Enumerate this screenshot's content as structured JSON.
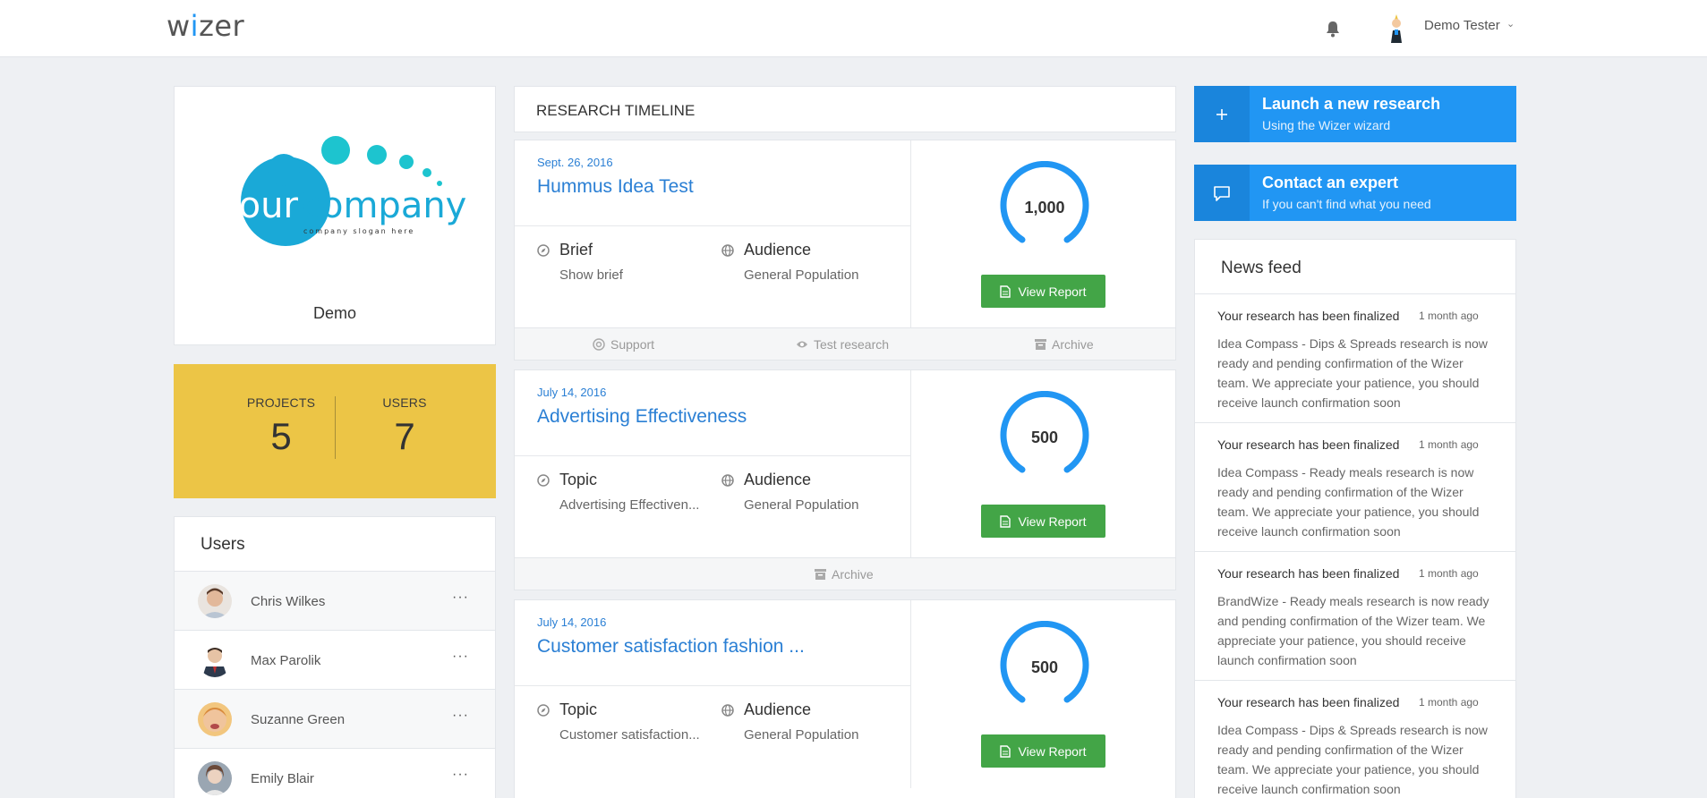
{
  "header": {
    "logo_text_a": "w",
    "logo_text_i": "i",
    "logo_text_b": "zer",
    "user_name": "Demo Tester",
    "icons": [
      "bell-icon",
      "chevron-down-icon"
    ]
  },
  "company": {
    "logo_word_a": "your",
    "logo_word_b": "company",
    "logo_slogan": "company slogan here",
    "name": "Demo"
  },
  "stats": {
    "projects_label": "PROJECTS",
    "projects_value": "5",
    "users_label": "USERS",
    "users_value": "7",
    "color": "#ecc546"
  },
  "users": {
    "title": "Users",
    "items": [
      {
        "name": "Chris Wilkes",
        "more": "···"
      },
      {
        "name": "Max Parolik",
        "more": "···"
      },
      {
        "name": "Suzanne Green",
        "more": "···"
      },
      {
        "name": "Emily Blair",
        "more": "···"
      }
    ]
  },
  "timeline": {
    "title": "RESEARCH TIMELINE",
    "items": [
      {
        "date": "Sept. 26, 2016",
        "title": "Hummus Idea Test",
        "field1_label": "Brief",
        "field1_value": "Show brief",
        "field2_label": "Audience",
        "field2_value": "General Population",
        "count": "1,000",
        "button": "View Report",
        "footer": [
          "Support",
          "Test research",
          "Archive"
        ]
      },
      {
        "date": "July 14, 2016",
        "title": "Advertising Effectiveness",
        "field1_label": "Topic",
        "field1_value": "Advertising Effectiven...",
        "field2_label": "Audience",
        "field2_value": "General Population",
        "count": "500",
        "button": "View Report",
        "footer": [
          "Archive"
        ]
      },
      {
        "date": "July 14, 2016",
        "title": "Customer satisfaction fashion ...",
        "field1_label": "Topic",
        "field1_value": "Customer satisfaction...",
        "field2_label": "Audience",
        "field2_value": "General Population",
        "count": "500",
        "button": "View Report",
        "footer": []
      }
    ]
  },
  "actions": {
    "launch_title": "Launch a new research",
    "launch_sub": "Using the Wizer wizard",
    "contact_title": "Contact an expert",
    "contact_sub": "If you can't find what you need",
    "accent": "#2196f3"
  },
  "news": {
    "title": "News feed",
    "items": [
      {
        "head": "Your research has been finalized",
        "time": "1 month ago",
        "body": "Idea Compass - Dips & Spreads research is now ready and pending confirmation of the Wizer team. We appreciate your patience, you should receive launch confirmation soon"
      },
      {
        "head": "Your research has been finalized",
        "time": "1 month ago",
        "body": "Idea Compass - Ready meals research is now ready and pending confirmation of the Wizer team. We appreciate your patience, you should receive launch confirmation soon"
      },
      {
        "head": "Your research has been finalized",
        "time": "1 month ago",
        "body": "BrandWize - Ready meals research is now ready and pending confirmation of the Wizer team. We appreciate your patience, you should receive launch confirmation soon"
      },
      {
        "head": "Your research has been finalized",
        "time": "1 month ago",
        "body": "Idea Compass - Dips & Spreads research is now ready and pending confirmation of the Wizer team. We appreciate your patience, you should receive launch confirmation soon"
      }
    ]
  }
}
